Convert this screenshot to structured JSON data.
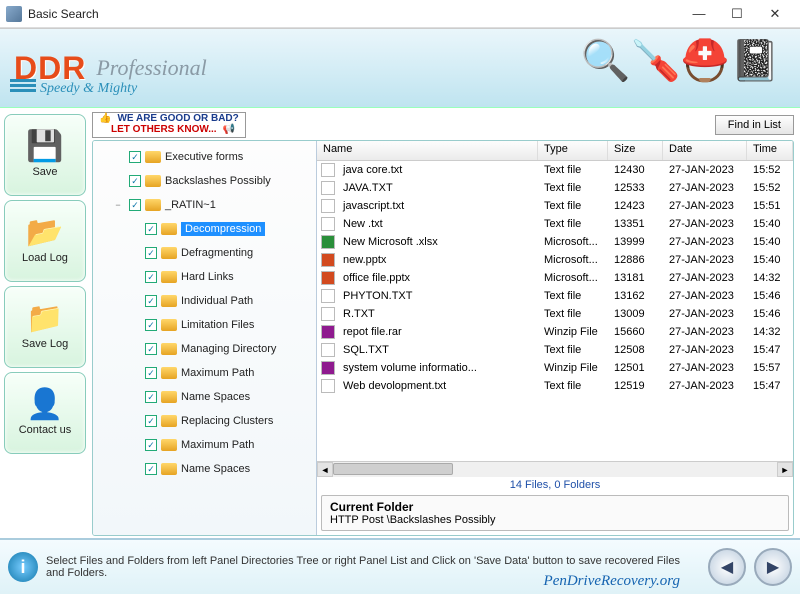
{
  "window": {
    "title": "Basic Search"
  },
  "banner": {
    "brand": "DDR",
    "subtitle": "Professional",
    "tagline": "Speedy & Mighty"
  },
  "sidebar": {
    "buttons": [
      {
        "label": "Save",
        "icon": "💾"
      },
      {
        "label": "Load Log",
        "icon": "📂"
      },
      {
        "label": "Save Log",
        "icon": "📁"
      },
      {
        "label": "Contact us",
        "icon": "👤"
      }
    ]
  },
  "rating": {
    "line1": "WE ARE GOOD OR BAD?",
    "line2": "LET OTHERS KNOW..."
  },
  "find_button": "Find in List",
  "tree": {
    "items": [
      {
        "indent": 1,
        "label": "Executive forms",
        "twist": ""
      },
      {
        "indent": 1,
        "label": "Backslashes Possibly",
        "twist": ""
      },
      {
        "indent": 1,
        "label": "_RATIN~1",
        "twist": "−"
      },
      {
        "indent": 2,
        "label": "Decompression",
        "twist": "",
        "selected": true
      },
      {
        "indent": 2,
        "label": "Defragmenting",
        "twist": ""
      },
      {
        "indent": 2,
        "label": "Hard Links",
        "twist": ""
      },
      {
        "indent": 2,
        "label": "Individual Path",
        "twist": ""
      },
      {
        "indent": 2,
        "label": "Limitation Files",
        "twist": ""
      },
      {
        "indent": 2,
        "label": "Managing Directory",
        "twist": ""
      },
      {
        "indent": 2,
        "label": "Maximum Path",
        "twist": ""
      },
      {
        "indent": 2,
        "label": "Name Spaces",
        "twist": ""
      },
      {
        "indent": 2,
        "label": "Replacing Clusters",
        "twist": ""
      },
      {
        "indent": 2,
        "label": "Maximum Path",
        "twist": ""
      },
      {
        "indent": 2,
        "label": "Name Spaces",
        "twist": ""
      }
    ]
  },
  "columns": {
    "name": "Name",
    "type": "Type",
    "size": "Size",
    "date": "Date",
    "time": "Time"
  },
  "files": [
    {
      "name": "java core.txt",
      "type": "Text file",
      "size": "12430",
      "date": "27-JAN-2023",
      "time": "15:52",
      "ic": ""
    },
    {
      "name": "JAVA.TXT",
      "type": "Text file",
      "size": "12533",
      "date": "27-JAN-2023",
      "time": "15:52",
      "ic": ""
    },
    {
      "name": "javascript.txt",
      "type": "Text file",
      "size": "12423",
      "date": "27-JAN-2023",
      "time": "15:51",
      "ic": ""
    },
    {
      "name": "New .txt",
      "type": "Text file",
      "size": "13351",
      "date": "27-JAN-2023",
      "time": "15:40",
      "ic": ""
    },
    {
      "name": "New Microsoft .xlsx",
      "type": "Microsoft...",
      "size": "13999",
      "date": "27-JAN-2023",
      "time": "15:40",
      "ic": "xl"
    },
    {
      "name": "new.pptx",
      "type": "Microsoft...",
      "size": "12886",
      "date": "27-JAN-2023",
      "time": "15:40",
      "ic": "pp"
    },
    {
      "name": "office file.pptx",
      "type": "Microsoft...",
      "size": "13181",
      "date": "27-JAN-2023",
      "time": "14:32",
      "ic": "pp"
    },
    {
      "name": "PHYTON.TXT",
      "type": "Text file",
      "size": "13162",
      "date": "27-JAN-2023",
      "time": "15:46",
      "ic": ""
    },
    {
      "name": "R.TXT",
      "type": "Text file",
      "size": "13009",
      "date": "27-JAN-2023",
      "time": "15:46",
      "ic": ""
    },
    {
      "name": "repot file.rar",
      "type": "Winzip File",
      "size": "15660",
      "date": "27-JAN-2023",
      "time": "14:32",
      "ic": "rr"
    },
    {
      "name": "SQL.TXT",
      "type": "Text file",
      "size": "12508",
      "date": "27-JAN-2023",
      "time": "15:47",
      "ic": ""
    },
    {
      "name": "system volume informatio...",
      "type": "Winzip File",
      "size": "12501",
      "date": "27-JAN-2023",
      "time": "15:57",
      "ic": "rr"
    },
    {
      "name": "Web devolopment.txt",
      "type": "Text file",
      "size": "12519",
      "date": "27-JAN-2023",
      "time": "15:47",
      "ic": ""
    }
  ],
  "status": "14 Files, 0 Folders",
  "current_folder": {
    "title": "Current Folder",
    "path": "HTTP Post \\Backslashes Possibly"
  },
  "footer": {
    "hint": "Select Files and Folders from left Panel Directories Tree or right Panel List and Click on 'Save Data' button to save recovered Files and Folders.",
    "brand": "PenDriveRecovery.org"
  }
}
